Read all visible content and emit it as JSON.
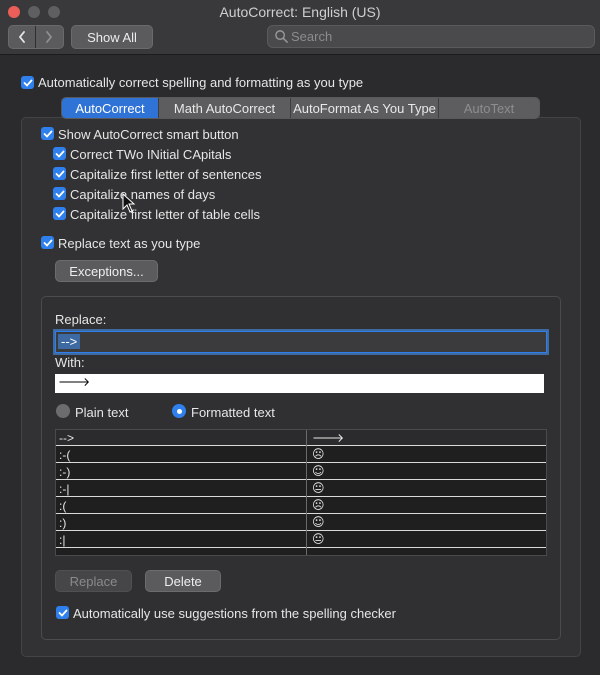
{
  "window": {
    "title": "AutoCorrect: English (US)"
  },
  "toolbar": {
    "back_label": "‹",
    "forward_label": "›",
    "show_all_label": "Show All",
    "search_placeholder": "Search"
  },
  "main_checkbox": {
    "label": "Automatically correct spelling and formatting as you type",
    "checked": true
  },
  "tabs": [
    {
      "label": "AutoCorrect",
      "state": "active"
    },
    {
      "label": "Math AutoCorrect",
      "state": "normal"
    },
    {
      "label": "AutoFormat As You Type",
      "state": "normal"
    },
    {
      "label": "AutoText",
      "state": "disabled"
    }
  ],
  "options": {
    "smart_button": {
      "label": "Show AutoCorrect smart button",
      "checked": true
    },
    "two_initial": {
      "label": "Correct TWo INitial CApitals",
      "checked": true
    },
    "first_letter": {
      "label": "Capitalize first letter of sentences",
      "checked": true
    },
    "names_days": {
      "label": "Capitalize names of days",
      "checked": true
    },
    "table_cells": {
      "label": "Capitalize first letter of table cells",
      "checked": true
    },
    "replace_text": {
      "label": "Replace text as you type",
      "checked": true
    }
  },
  "exceptions_label": "Exceptions...",
  "replace_section": {
    "replace_label": "Replace:",
    "replace_value": "-->",
    "with_label": "With:",
    "with_value": "🡒",
    "plain_text_label": "Plain text",
    "formatted_text_label": "Formatted text",
    "selected_format": "Formatted text"
  },
  "table": {
    "rows": [
      {
        "replace": "-->",
        "with": "🡒"
      },
      {
        "replace": ":-(",
        "with": "☹"
      },
      {
        "replace": ":-)",
        "with": "☺"
      },
      {
        "replace": ":-|",
        "with": "😐"
      },
      {
        "replace": ":(",
        "with": "☹"
      },
      {
        "replace": ":)",
        "with": "☺"
      },
      {
        "replace": ":|",
        "with": "😐"
      }
    ]
  },
  "buttons": {
    "replace_label": "Replace",
    "delete_label": "Delete"
  },
  "spelling_checkbox": {
    "label": "Automatically use suggestions from the spelling checker",
    "checked": true
  },
  "colors": {
    "accent": "#2f80ed",
    "background": "#2b2b2d",
    "close": "#ec5f58"
  }
}
